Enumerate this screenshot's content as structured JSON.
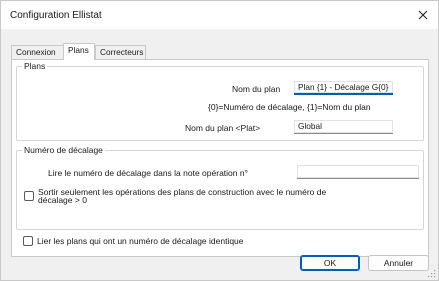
{
  "window": {
    "title": "Configuration Ellistat",
    "close_glyph": "✕"
  },
  "tabs": [
    {
      "label": "Connexion",
      "active": false
    },
    {
      "label": "Plans",
      "active": true
    },
    {
      "label": "Correcteurs",
      "active": false
    }
  ],
  "plans_group": {
    "legend": "Plans",
    "plan_name_label": "Nom du plan",
    "plan_name_value": "Plan {1} - Décalage G{0}",
    "plan_name_hint": "{0}=Numéro de décalage, {1}=Nom du plan",
    "plat_plan_name_label": "Nom du plan <Plat>",
    "plat_plan_name_value": "Global"
  },
  "offset_group": {
    "legend": "Numéro de décalage",
    "read_offset_label": "Lire le numéro de décalage dans la note opération n°",
    "read_offset_value": "",
    "only_offset_option": {
      "label_line1": "Sortir seulement les opérations des plans de construction avec le numéro de",
      "label_line2": "décalage > 0",
      "checked": false
    }
  },
  "link_plans_option": {
    "label": "Lier les plans qui ont un numéro de décalage identique",
    "checked": false
  },
  "footer": {
    "ok_label": "OK",
    "cancel_label": "Annuler"
  },
  "colors": {
    "accent": "#005fb8",
    "window_background": "#f0f0f0",
    "panel_background": "#ffffff"
  },
  "icons": {
    "close": "close-icon",
    "resize": "resize-grip-icon"
  }
}
